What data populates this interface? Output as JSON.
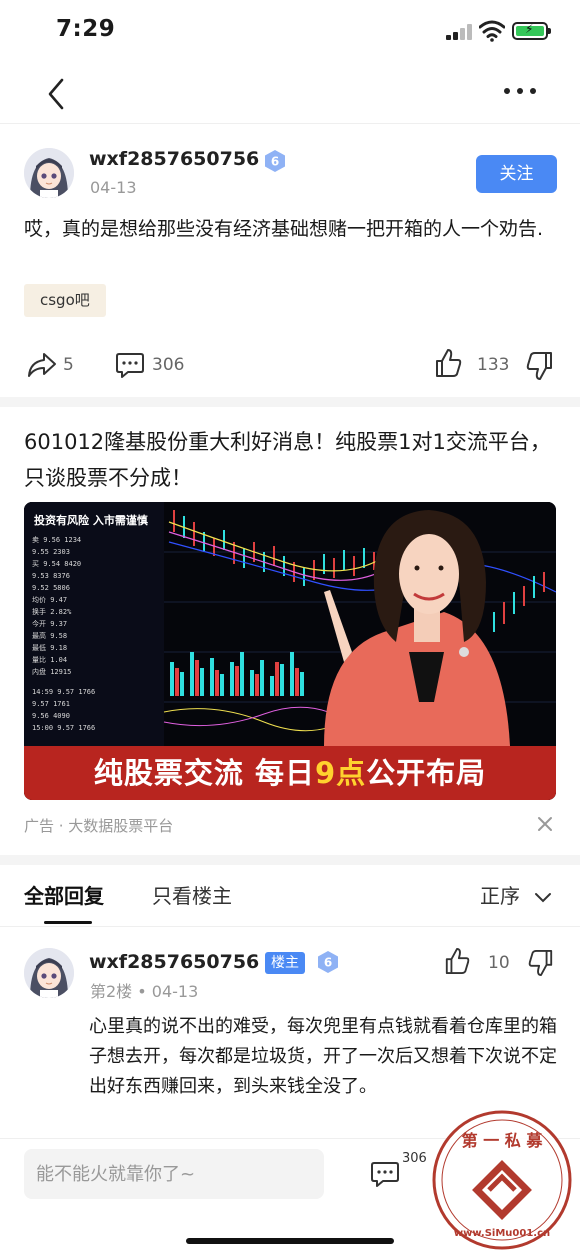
{
  "status_bar": {
    "time": "7:29"
  },
  "post": {
    "username": "wxf2857650756",
    "level": "6",
    "date": "04-13",
    "follow_label": "关注",
    "text": "哎，真的是想给那些没有经济基础想赌一把开箱的人一个劝告.",
    "tag": "csgo吧",
    "share_count": "5",
    "comment_count": "306",
    "like_count": "133"
  },
  "ad": {
    "title": "601012隆基股份重大利好消息！纯股票1对1交流平台，只谈股票不分成！",
    "image_overlay_text": "投资有风险 入市需谨慎",
    "banner_part1": "纯股票交流 每日",
    "banner_highlight": "9点",
    "banner_part2": "公开布局",
    "source": "广告 · 大数据股票平台"
  },
  "reply_tabs": {
    "all": "全部回复",
    "owner_only": "只看楼主",
    "sort": "正序"
  },
  "reply": {
    "username": "wxf2857650756",
    "owner_badge": "楼主",
    "level": "6",
    "floor_date": "第2楼 • 04-13",
    "like_count": "10",
    "text": "心里真的说不出的难受，每次兜里有点钱就看着仓库里的箱子想去开，每次都是垃圾货，开了一次后又想着下次说不定出好东西赚回来，到头来钱全没了。"
  },
  "bottom_bar": {
    "placeholder": "能不能火就靠你了~",
    "comment_count": "306"
  },
  "watermark": {
    "text": "第一私募",
    "url": "www.SiMu001.cn"
  },
  "colors": {
    "accent": "#4a89f4",
    "tag_bg": "#f6efe3",
    "ad_banner": "#b8251f"
  }
}
